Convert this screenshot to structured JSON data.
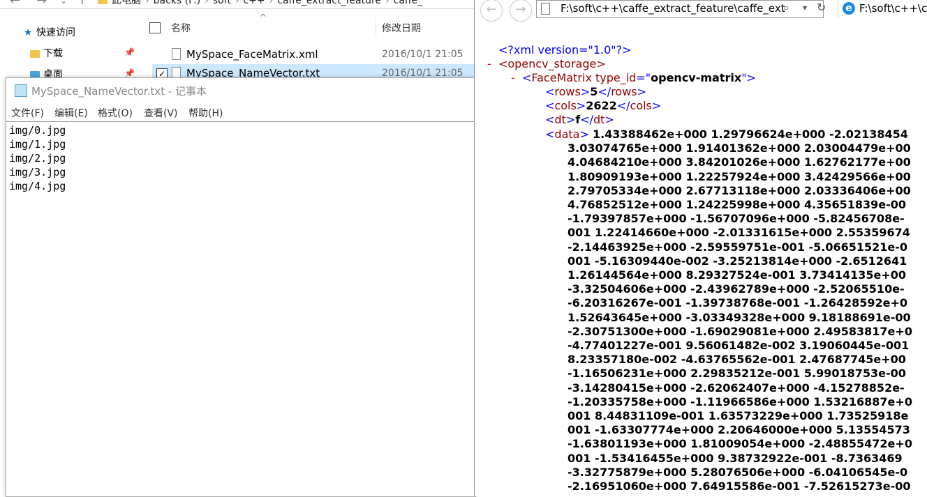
{
  "explorer": {
    "breadcrumbs": [
      "此电脑",
      "backs (F:)",
      "soft",
      "c++",
      "caffe_extract_feature",
      "caffe_"
    ],
    "nav": {
      "quick_access": "快速访问",
      "downloads": "下载",
      "desktop": "桌面"
    },
    "columns": {
      "name": "名称",
      "modified": "修改日期"
    },
    "files": [
      {
        "name": "MySpace_FaceMatrix.xml",
        "date": "2016/10/1 21:05",
        "selected": false
      },
      {
        "name": "MySpace_NameVector.txt",
        "date": "2016/10/1 21:05",
        "selected": true
      }
    ]
  },
  "notepad": {
    "title": "MySpace_NameVector.txt - 记事本",
    "menu": [
      "文件(F)",
      "编辑(E)",
      "格式(O)",
      "查看(V)",
      "帮助(H)"
    ],
    "lines": [
      "img/0.jpg",
      "img/1.jpg",
      "img/2.jpg",
      "img/3.jpg",
      "img/4.jpg"
    ]
  },
  "ie": {
    "address": "F:\\soft\\c++\\caffe_extract_feature\\caffe_ext",
    "tab_title": "F:\\soft\\c++\\c",
    "xml": {
      "declaration": "<?xml version=\"1.0\"?>",
      "root_open": "<opencv_storage>",
      "matrix_tag": "FaceMatrix",
      "type_attr": "type_id",
      "type_value": "opencv-matrix",
      "rows": "5",
      "cols": "2622",
      "dt": "f",
      "data_lines": [
        "1.43388462e+000 1.29796624e+000 -2.02138454",
        "3.03074765e+000 1.91401362e+000 2.03004479e+00",
        "4.04684210e+000 3.84201026e+000 1.62762177e+00",
        "1.80909193e+000 1.22257924e+000 3.42429566e+00",
        "2.79705334e+000 2.67713118e+000 2.03336406e+00",
        "4.76852512e+000 1.24225998e+000 4.35651839e-00",
        "-1.79397857e+000 -1.56707096e+000 -5.82456708e-",
        "001 1.22414660e+000 -2.01331615e+000 2.55359674",
        "-2.14463925e+000 -2.59559751e-001 -5.06651521e-0",
        "001 -5.16309440e-002 -3.25213814e+000 -2.6512641",
        "1.26144564e+000 8.29327524e-001 3.73414135e+00",
        "-3.32504606e+000 -2.43962789e+000 -2.52065510e-",
        "-6.20316267e-001 -1.39738768e-001 -1.26428592e+0",
        "1.52643645e+000 -3.03349328e+000 9.18188691e-00",
        "-2.30751300e+000 -1.69029081e+000 2.49583817e+0",
        "-4.77401227e-001 9.56061482e-002 3.19060445e-001",
        "8.23357180e-002 -4.63765562e-001 2.47687745e+00",
        "-1.16506231e+000 2.29835212e-001 5.99018753e-00",
        "-3.14280415e+000 -2.62062407e+000 -4.15278852e-",
        "-1.20335758e+000 -1.11966586e+000 1.53216887e+0",
        "001 8.44831109e-001 1.63573229e+000 1.73525918e",
        "001 -1.63307774e+000 2.20646000e+000 5.13554573",
        "-1.63801193e+000 1.81009054e+000 -2.48855472e+0",
        "001 -1.53416455e+000 9.38732922e-001 -8.7363469",
        "-3.32775879e+000 5.28076506e+000 -6.04106545e-0",
        "-2.16951060e+000 7.64915586e-001 -7.52615273e-00"
      ]
    }
  }
}
